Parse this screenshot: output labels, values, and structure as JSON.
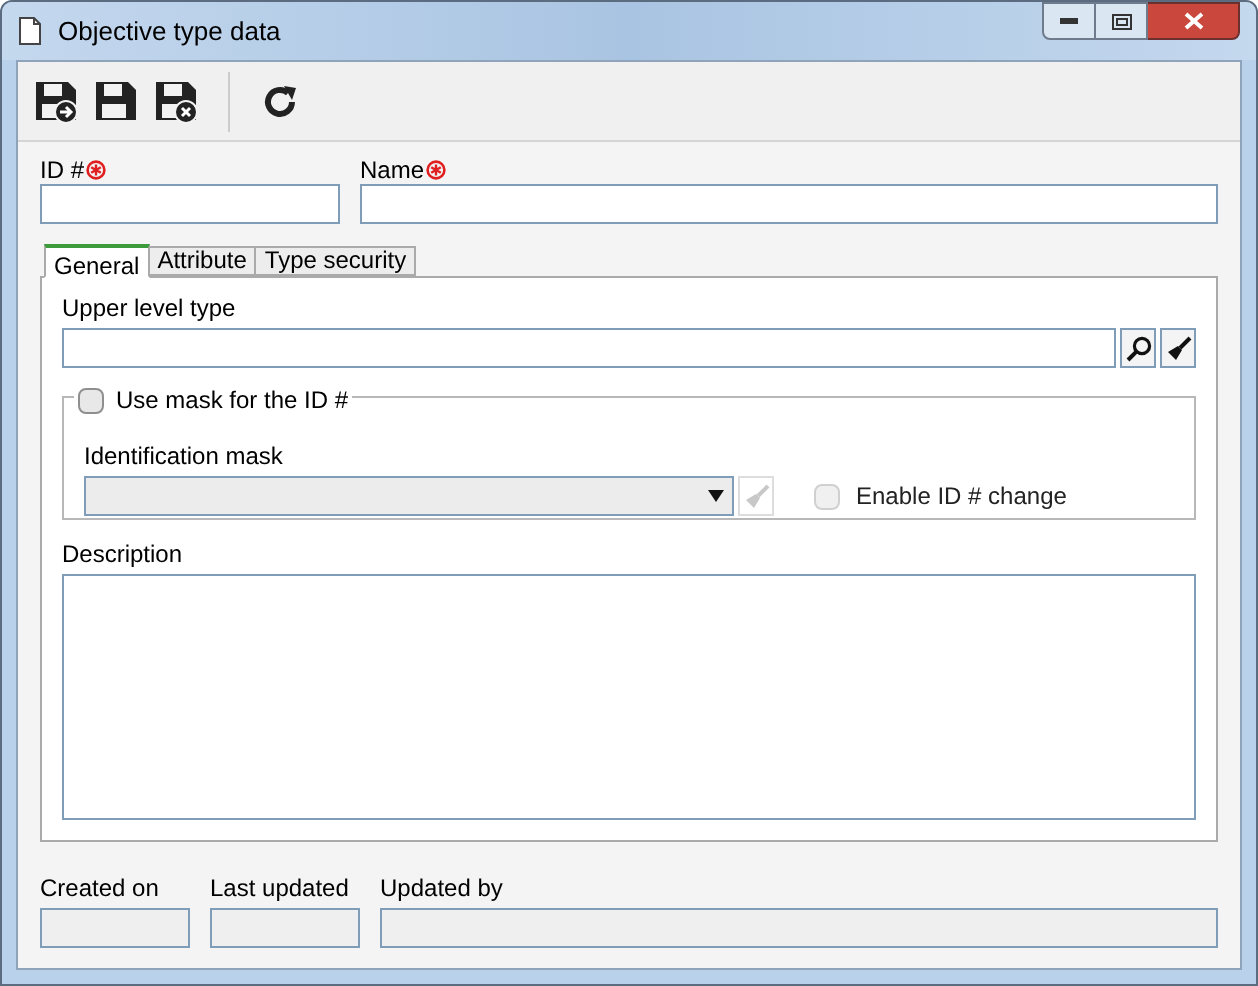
{
  "window": {
    "title": "Objective type data"
  },
  "fields": [
    {
      "label": "ID #",
      "required": true
    },
    {
      "label": "Name",
      "required": true
    }
  ],
  "tabs": [
    {
      "label": "General",
      "selected": true
    },
    {
      "label": "Attribute",
      "selected": false
    },
    {
      "label": "Type security",
      "selected": false
    }
  ],
  "upper_level_type": {
    "label": "Upper level type"
  },
  "mask_group": {
    "label": "Use mask for the ID #",
    "checked": false,
    "identification_mask": {
      "label": "Identification mask",
      "disabled": true
    },
    "enable_change": {
      "label": "Enable ID # change",
      "checked": false,
      "disabled": true
    }
  },
  "description": {
    "label": "Description"
  },
  "footer": [
    {
      "label": "Created on"
    },
    {
      "label": "Last updated"
    },
    {
      "label": "Updated by"
    }
  ]
}
